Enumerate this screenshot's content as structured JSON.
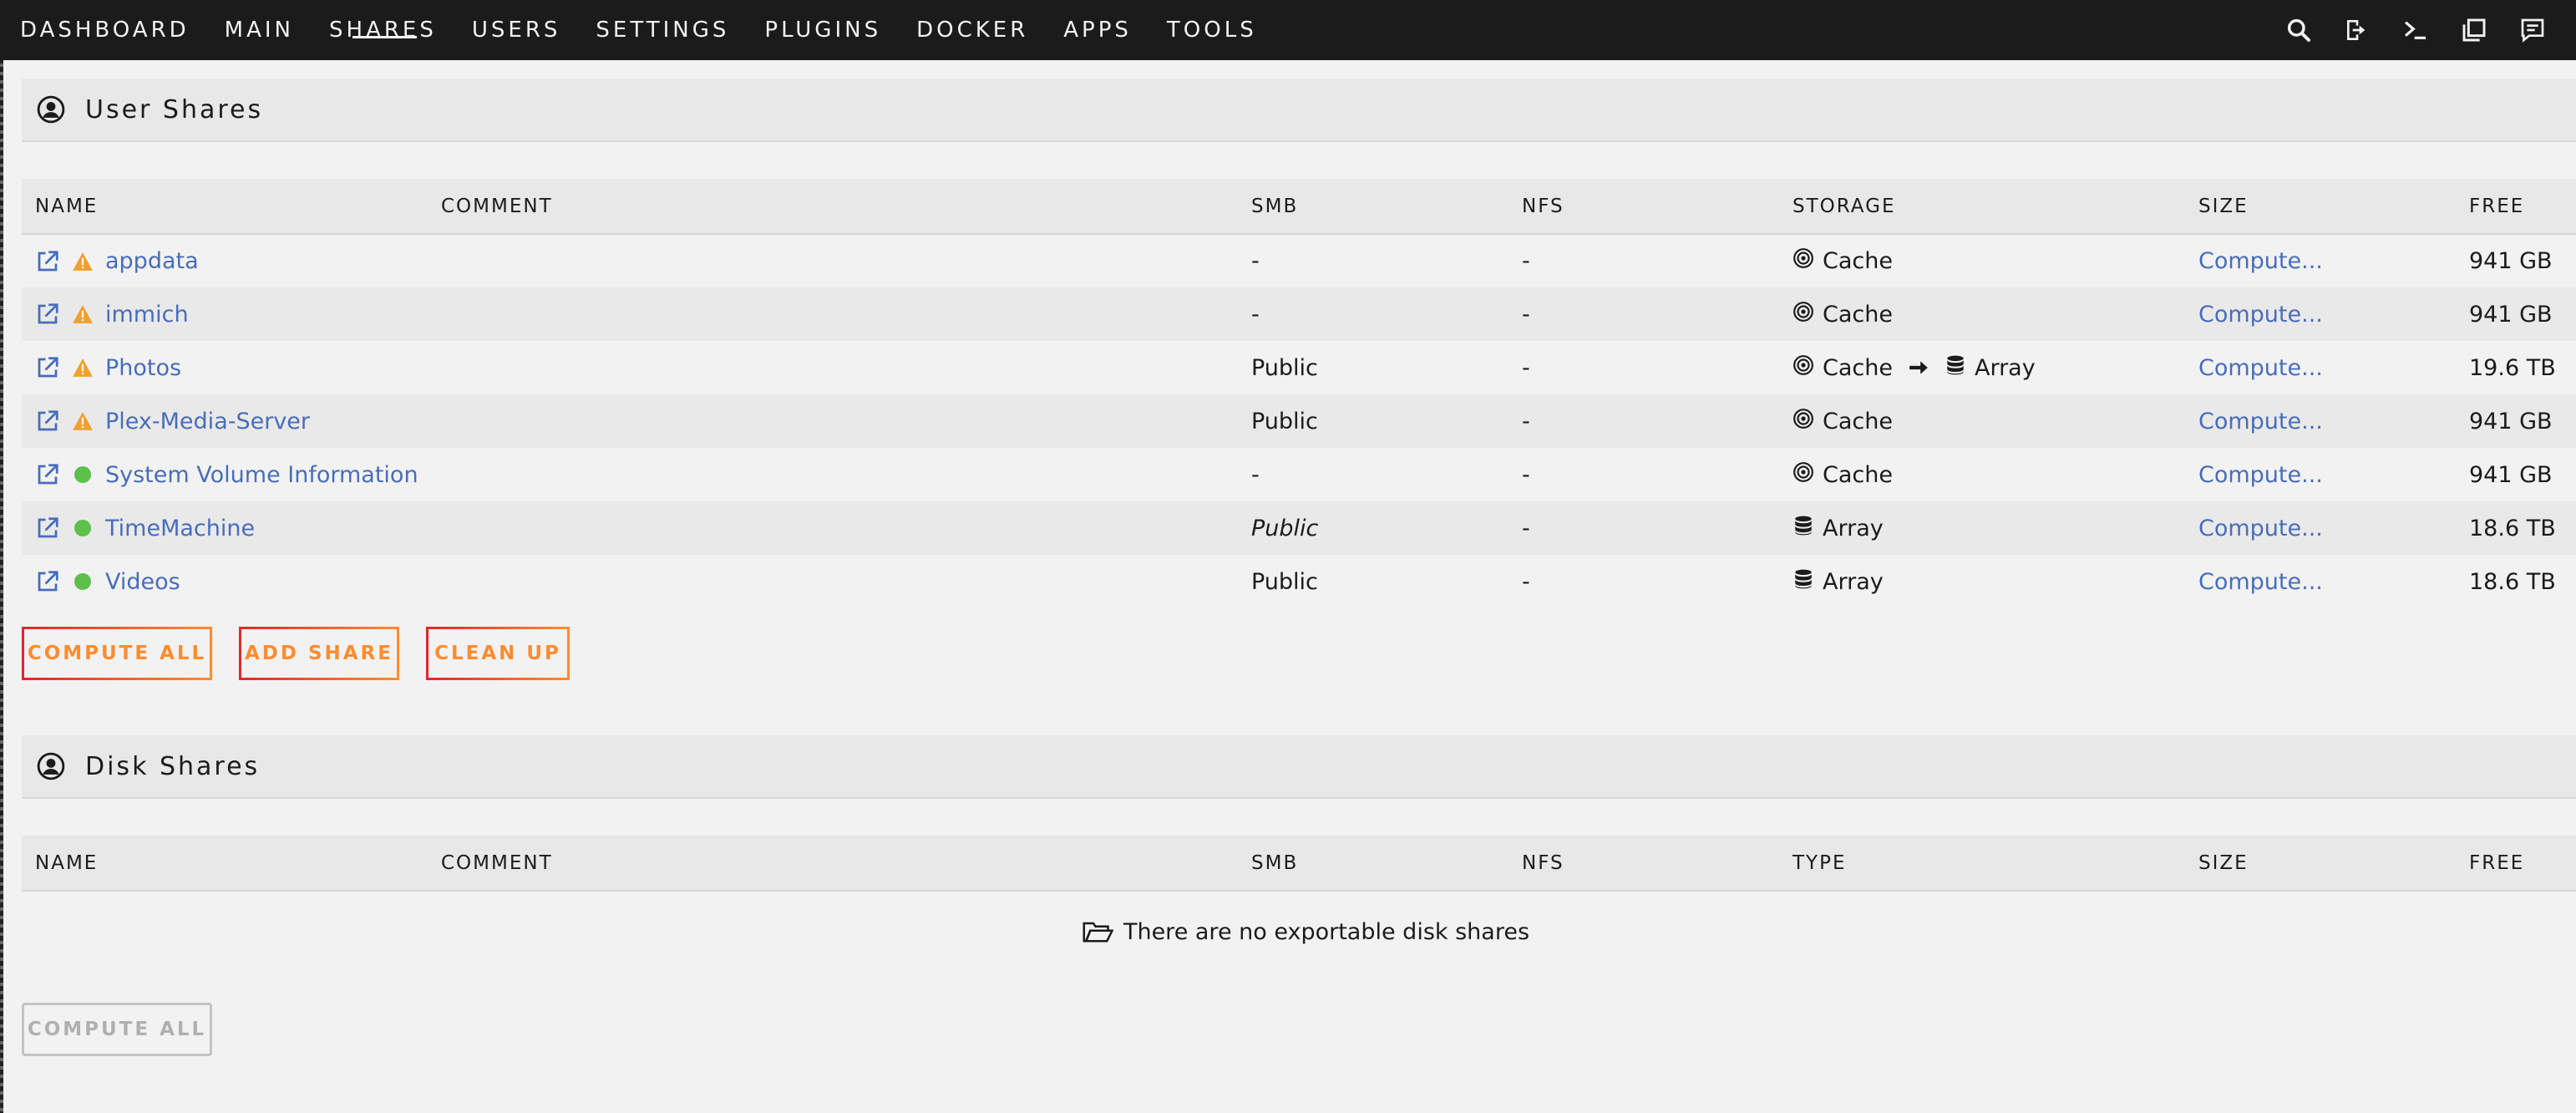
{
  "nav": {
    "items": [
      {
        "label": "DASHBOARD",
        "key": "dashboard"
      },
      {
        "label": "MAIN",
        "key": "main"
      },
      {
        "label": "SHARES",
        "key": "shares",
        "active": true
      },
      {
        "label": "USERS",
        "key": "users"
      },
      {
        "label": "SETTINGS",
        "key": "settings"
      },
      {
        "label": "PLUGINS",
        "key": "plugins"
      },
      {
        "label": "DOCKER",
        "key": "docker"
      },
      {
        "label": "APPS",
        "key": "apps"
      },
      {
        "label": "TOOLS",
        "key": "tools"
      }
    ],
    "icons": [
      "search-icon",
      "logout-icon",
      "terminal-icon",
      "new-window-icon",
      "notifications-icon"
    ]
  },
  "user_shares": {
    "title": "User Shares",
    "columns": [
      "NAME",
      "COMMENT",
      "SMB",
      "NFS",
      "STORAGE",
      "SIZE",
      "FREE"
    ],
    "rows": [
      {
        "name": "appdata",
        "status": "warning",
        "comment": "",
        "smb": "-",
        "smb_italic": false,
        "nfs": "-",
        "storage": "Cache",
        "storage_to": "",
        "size": "Compute...",
        "free": "941 GB"
      },
      {
        "name": "immich",
        "status": "warning",
        "comment": "",
        "smb": "-",
        "smb_italic": false,
        "nfs": "-",
        "storage": "Cache",
        "storage_to": "",
        "size": "Compute...",
        "free": "941 GB"
      },
      {
        "name": "Photos",
        "status": "warning",
        "comment": "",
        "smb": "Public",
        "smb_italic": false,
        "nfs": "-",
        "storage": "Cache",
        "storage_to": "Array",
        "size": "Compute...",
        "free": "19.6 TB"
      },
      {
        "name": "Plex-Media-Server",
        "status": "warning",
        "comment": "",
        "smb": "Public",
        "smb_italic": false,
        "nfs": "-",
        "storage": "Cache",
        "storage_to": "",
        "size": "Compute...",
        "free": "941 GB"
      },
      {
        "name": "System Volume Information",
        "status": "ok",
        "comment": "",
        "smb": "-",
        "smb_italic": false,
        "nfs": "-",
        "storage": "Cache",
        "storage_to": "",
        "size": "Compute...",
        "free": "941 GB"
      },
      {
        "name": "TimeMachine",
        "status": "ok",
        "comment": "",
        "smb": "Public",
        "smb_italic": true,
        "nfs": "-",
        "storage": "Array",
        "storage_to": "",
        "size": "Compute...",
        "free": "18.6 TB"
      },
      {
        "name": "Videos",
        "status": "ok",
        "comment": "",
        "smb": "Public",
        "smb_italic": false,
        "nfs": "-",
        "storage": "Array",
        "storage_to": "",
        "size": "Compute...",
        "free": "18.6 TB"
      }
    ],
    "buttons": {
      "compute_all": "COMPUTE ALL",
      "add_share": "ADD SHARE",
      "clean_up": "CLEAN UP"
    }
  },
  "disk_shares": {
    "title": "Disk Shares",
    "columns": [
      "NAME",
      "COMMENT",
      "SMB",
      "NFS",
      "TYPE",
      "SIZE",
      "FREE"
    ],
    "empty_message": "There are no exportable disk shares",
    "buttons": {
      "compute_all": "COMPUTE ALL"
    }
  },
  "colors": {
    "topbar": "#1c1b1b",
    "link": "#486dba",
    "warning": "#f0a030",
    "ok": "#5cc04a",
    "button_gradient_start": "#e22828",
    "button_gradient_end": "#ff8c2f"
  }
}
